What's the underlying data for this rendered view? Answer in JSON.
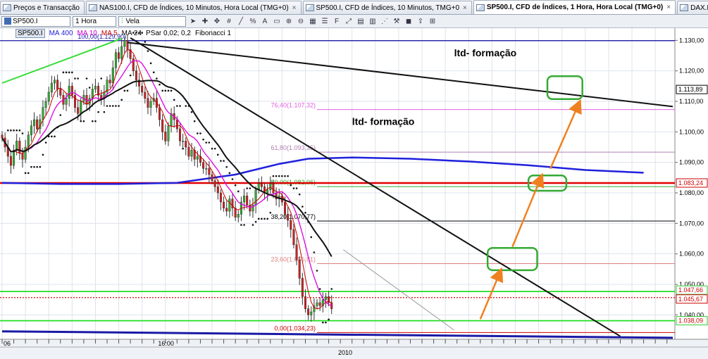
{
  "tabs": [
    {
      "label": "Preços e Transacção",
      "active": false
    },
    {
      "label": "NAS100.I, CFD de Índices, 10 Minutos, Hora Local (TMG+0)",
      "active": false
    },
    {
      "label": "SP500.I, CFD de Índices, 10 Minutos, TMG+0",
      "active": false
    },
    {
      "label": "SP500.I, CFD de Índices, 1 Hora, Hora Local (TMG+0)",
      "active": true
    },
    {
      "label": "DAX.I, CFD de",
      "active": false
    }
  ],
  "toolbar": {
    "symbol": "SP500.I",
    "timeframe": "1 Hora",
    "chart_type": "Vela",
    "icons": [
      "cursor-icon",
      "crosshair-icon",
      "pan-icon",
      "grid-icon",
      "line-tool-icon",
      "percent-icon",
      "text-tool-icon",
      "rectangle-icon",
      "zoom-in-icon",
      "zoom-out-icon",
      "layout-icon",
      "sliders-icon",
      "fib-icon",
      "fit-icon",
      "grid-view-icon",
      "table-icon",
      "fan-icon",
      "tools-icon",
      "lock-icon",
      "share-icon",
      "expand-icon"
    ]
  },
  "indicator_bar": {
    "symbol": "SP500.I",
    "items": [
      {
        "label": "MA 400",
        "color": "#1f1fd6"
      },
      {
        "label": "MA 10",
        "color": "#d000d0"
      },
      {
        "label": "MA 5",
        "color": "#cc0000"
      },
      {
        "label": "MA 24",
        "color": "#000000"
      },
      {
        "label": "PSar 0,02; 0,2",
        "color": "#000000"
      },
      {
        "label": "Fibonacci 1",
        "color": "#000000"
      }
    ]
  },
  "annotations": {
    "ltd_top": "ltd- formação",
    "ltd_mid": "ltd- formação"
  },
  "chart_data": {
    "type": "candlestick",
    "symbol": "SP500.I",
    "timeframe": "1 Hora",
    "y_range": [
      1032,
      1134
    ],
    "y_ticks": [
      "1.130,00",
      "1.120,00",
      "1.110,00",
      "1.100,00",
      "1.090,00",
      "1.080,00",
      "1.070,00",
      "1.060,00",
      "1.050,00",
      "1.040,00"
    ],
    "y_tick_values": [
      1130,
      1120,
      1110,
      1100,
      1090,
      1080,
      1070,
      1060,
      1050,
      1040
    ],
    "x_labels": [
      {
        "label": "06",
        "index": 0
      },
      {
        "label": "16:00",
        "index": 53
      }
    ],
    "x_sub_label": "2010",
    "fibonacci": [
      {
        "label": "100,00(1.129,90)",
        "value": 1129.9,
        "color": "#1a1aa6"
      },
      {
        "label": "76,40(1.107,32)",
        "value": 1107.32,
        "color": "#e060e0"
      },
      {
        "label": "61,80(1.093,35)",
        "value": 1093.35,
        "color": "#b080b0"
      },
      {
        "label": "50,00(1.082,06)",
        "value": 1082.06,
        "color": "#33aa33"
      },
      {
        "label": "38,20(1.070,77)",
        "value": 1070.77,
        "color": "#000000"
      },
      {
        "label": "23,60(1.056,81)",
        "value": 1056.81,
        "color": "#e08080"
      },
      {
        "label": "0,00(1.034,23)",
        "value": 1034.23,
        "color": "#cc0000"
      }
    ],
    "price_tags": [
      {
        "label": "1.113,89",
        "value": 1113.89,
        "bg": "#ffffff",
        "fg": "#000000",
        "border": "#000000"
      },
      {
        "label": "1.083,24",
        "value": 1083.24,
        "bg": "#ffffff",
        "fg": "#cc0000",
        "border": "#cc0000"
      },
      {
        "label": "1.047,66",
        "value": 1047.66,
        "bg": "#ffffff",
        "fg": "#cc0000",
        "border": "#33cc33"
      },
      {
        "label": "1.045,67",
        "value": 1045.67,
        "bg": "#ffffff",
        "fg": "#cc0000",
        "border": "#cc0000"
      },
      {
        "label": "1.038,09",
        "value": 1038.09,
        "bg": "#ffffff",
        "fg": "#cc0000",
        "border": "#33cc33"
      }
    ],
    "horizontal_lines": [
      {
        "value": 1129.9,
        "color": "#1a1aa6",
        "width": 1.2
      },
      {
        "value": 1083.24,
        "color": "#e00000",
        "width": 2.5
      },
      {
        "value": 1047.66,
        "color": "#22dd22",
        "width": 1.8
      },
      {
        "value": 1045.67,
        "color": "#dd0000",
        "width": 1.2,
        "dash": true
      },
      {
        "value": 1038.09,
        "color": "#22dd22",
        "width": 1.8
      }
    ],
    "closes": [
      1098,
      1095,
      1092,
      1089,
      1094,
      1097,
      1093,
      1091,
      1095,
      1099,
      1102,
      1104,
      1101,
      1104,
      1108,
      1110,
      1113,
      1116,
      1117,
      1114,
      1112,
      1109,
      1111,
      1115,
      1112,
      1108,
      1106,
      1110,
      1112,
      1109,
      1111,
      1114,
      1115,
      1112,
      1111,
      1113,
      1117,
      1116,
      1121,
      1126,
      1124,
      1128,
      1130,
      1127,
      1124,
      1120,
      1117,
      1115,
      1113,
      1111,
      1108,
      1110,
      1111,
      1108,
      1104,
      1100,
      1097,
      1102,
      1106,
      1104,
      1101,
      1097,
      1097,
      1095,
      1092,
      1094,
      1091,
      1092,
      1090,
      1088,
      1088,
      1086,
      1084,
      1082,
      1080,
      1077,
      1075,
      1074,
      1078,
      1075,
      1072,
      1073,
      1077,
      1079,
      1076,
      1074,
      1076,
      1081,
      1083,
      1082,
      1080,
      1081,
      1083,
      1080,
      1078,
      1079,
      1077,
      1073,
      1071,
      1068,
      1063,
      1058,
      1052,
      1046,
      1042,
      1040,
      1041,
      1043,
      1044,
      1043,
      1045,
      1046,
      1044,
      1042
    ],
    "ma400": [
      [
        0,
        1083.3
      ],
      [
        20,
        1082.9
      ],
      [
        40,
        1082.9
      ],
      [
        60,
        1083.3
      ],
      [
        80,
        1086
      ],
      [
        95,
        1089.5
      ],
      [
        105,
        1091.2
      ],
      [
        120,
        1091.6
      ],
      [
        140,
        1091.2
      ],
      [
        160,
        1090.3
      ],
      [
        180,
        1089.1
      ],
      [
        200,
        1087.5
      ],
      [
        220,
        1086.6
      ]
    ],
    "trendlines": [
      {
        "from": [
          0,
          1116.0
        ],
        "to": [
          41,
          1130.6
        ],
        "color": "#33dd33",
        "width": 2
      },
      {
        "from": [
          43,
          1129.3
        ],
        "to": [
          230,
          1108.3
        ],
        "color": "#111111",
        "width": 2
      },
      {
        "from": [
          44,
          1130.8
        ],
        "to": [
          212,
          1033.0
        ],
        "color": "#111111",
        "width": 2
      },
      {
        "from": [
          0,
          1034.6
        ],
        "to": [
          230,
          1032.5
        ],
        "color": "#1a1aa6",
        "width": 3
      },
      {
        "from": [
          117,
          1061.4
        ],
        "to": [
          155,
          1035.0
        ],
        "color": "#999999",
        "width": 1
      }
    ],
    "target_boxes": [
      {
        "center": [
          193,
          1114.5
        ],
        "w": 12,
        "h": 7.5,
        "color": "#33aa33"
      },
      {
        "center": [
          187,
          1083.2
        ],
        "w": 13,
        "h": 5,
        "color": "#33aa33"
      },
      {
        "center": [
          175,
          1058.3
        ],
        "w": 17,
        "h": 7.3,
        "color": "#33aa33"
      }
    ],
    "arrows": [
      {
        "from": [
          164,
          1038.6
        ],
        "to": [
          171,
          1054.5
        ]
      },
      {
        "from": [
          175,
          1062.3
        ],
        "to": [
          185,
          1085.5
        ]
      },
      {
        "from": [
          188,
          1087.9
        ],
        "to": [
          198,
          1109.7
        ]
      }
    ],
    "label_positions": {
      "ltd_top": [
        155,
        1124.8
      ],
      "ltd_mid": [
        120,
        1102.3
      ]
    }
  }
}
